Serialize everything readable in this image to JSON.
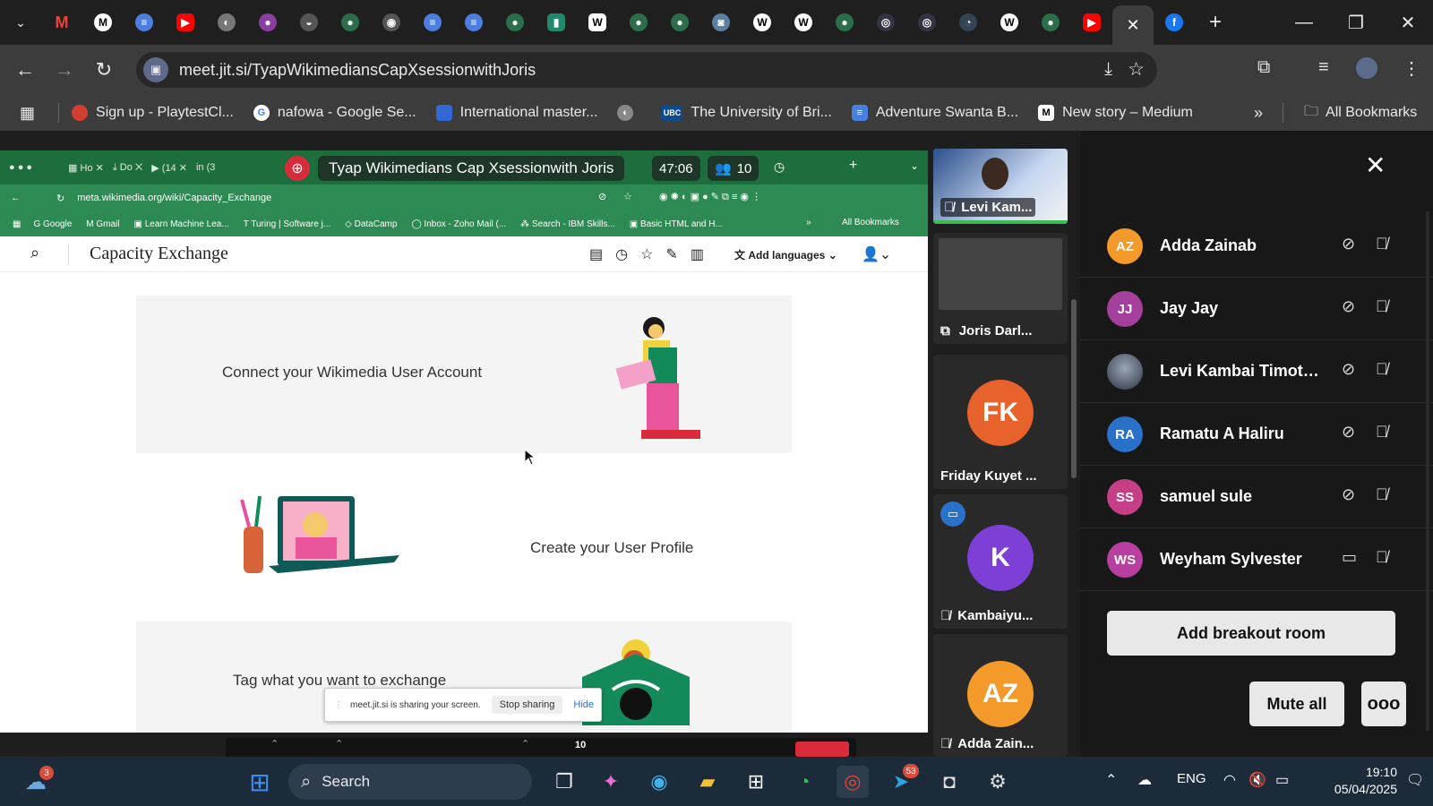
{
  "browser": {
    "url": "meet.jit.si/TyapWikimediansCapXsessionwithJoris",
    "tab_icons": [
      "tabs-menu-icon",
      "gmail-icon",
      "medium-icon",
      "docs-icon",
      "youtube-icon",
      "globe-icon",
      "app-icon",
      "app-icon",
      "app-icon",
      "app-icon",
      "app-icon",
      "docs-icon",
      "docs-icon",
      "app-icon",
      "app-icon",
      "wikipedia-icon",
      "app-icon",
      "app-icon",
      "app-icon",
      "wikipedia-icon",
      "wikipedia-icon",
      "app-icon",
      "app-icon",
      "app-icon",
      "app-icon",
      "wikipedia-icon",
      "app-icon",
      "youtube-icon",
      "jitsi-icon",
      "facebook-icon",
      "new-tab-icon"
    ],
    "bookmarks": [
      {
        "label": "Sign up - PlaytestCl...",
        "color": "#d23f31"
      },
      {
        "label": "nafowa - Google Se...",
        "color": "#4285f4"
      },
      {
        "label": "International master...",
        "color": "#3367d6"
      },
      {
        "label": "",
        "color": "#888888"
      },
      {
        "label": "The University of Bri...",
        "color": "#0f4a8a"
      },
      {
        "label": "Adventure Swanta B...",
        "color": "#4a7fe0"
      },
      {
        "label": "New story – Medium",
        "color": "#000000"
      }
    ],
    "all_bookmarks": "All Bookmarks"
  },
  "shared_screen": {
    "meeting_title": "Tyap Wikimedians Cap Xsessionwith Joris",
    "timer": "47:06",
    "participant_count": "10",
    "inner_url": "meta.wikimedia.org/wiki/Capacity_Exchange",
    "inner_bookmarks": [
      "Google",
      "Gmail",
      "Learn Machine Lea...",
      "Turing | Software j...",
      "DataCamp",
      "Inbox - Zoho Mail (...",
      "Search - IBM Skills...",
      "Basic HTML and H..."
    ],
    "inner_all_bookmarks": "All Bookmarks",
    "wiki_title": "Capacity Exchange",
    "add_languages": "Add languages",
    "card1": "Connect your Wikimedia User Account",
    "card2": "Create your User Profile",
    "card3": "Tag what you want to exchange",
    "share_notice": "meet.jit.si is sharing your screen.",
    "stop_sharing": "Stop sharing",
    "hide": "Hide",
    "toolbar_count": "10"
  },
  "filmstrip": [
    {
      "name": "Levi Kam...",
      "type": "video"
    },
    {
      "name": "Joris Darl...",
      "type": "screen"
    },
    {
      "name": "Friday Kuyet ...",
      "initials": "FK",
      "color": "#e8622b"
    },
    {
      "name": "Kambaiyu...",
      "initials": "K",
      "color": "#7e3fd6"
    },
    {
      "name": "Adda Zain...",
      "initials": "AZ",
      "color": "#f39a2b"
    }
  ],
  "participants": [
    {
      "name": "Adda Zainab",
      "initials": "AZ",
      "color": "#f39a2b"
    },
    {
      "name": "Jay Jay",
      "initials": "JJ",
      "color": "#a43f9c"
    },
    {
      "name": "Levi Kambai Timoth...",
      "initials": "",
      "color": "#556677"
    },
    {
      "name": "Ramatu A Haliru",
      "initials": "RA",
      "color": "#2a72c9"
    },
    {
      "name": "samuel sule",
      "initials": "SS",
      "color": "#c63f86"
    },
    {
      "name": "Weyham Sylvester",
      "initials": "WS",
      "color": "#b83ea0"
    }
  ],
  "panel": {
    "add_breakout": "Add breakout room",
    "mute_all": "Mute all",
    "more": "ooo"
  },
  "taskbar": {
    "search": "Search",
    "lang": "ENG",
    "time": "19:10",
    "date": "05/04/2025",
    "telegram_badge": "53",
    "notif_badge": "3"
  }
}
